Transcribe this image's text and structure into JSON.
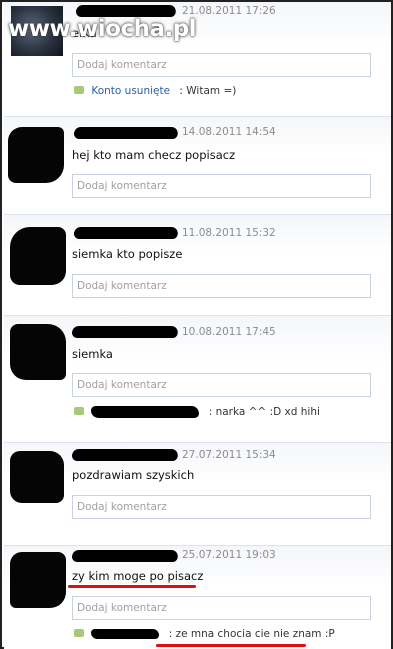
{
  "watermark": "www.wiocha.pl",
  "comment_placeholder": "Dodaj komentarz",
  "posts": [
    {
      "date": "21.08.2011 17:26",
      "text": "elKa",
      "reply": {
        "author": "Konto usunięte",
        "text": ": Witam =)"
      }
    },
    {
      "date": "14.08.2011 14:54",
      "text": "hej kto mam checz popisacz"
    },
    {
      "date": "11.08.2011 15:32",
      "text": "siemka kto popisze"
    },
    {
      "date": "10.08.2011 17:45",
      "text": "siemka",
      "reply": {
        "text": ": narka ^^ :D xd hihi"
      }
    },
    {
      "date": "27.07.2011 15:34",
      "text": "pozdrawiam szyskich"
    },
    {
      "date": "25.07.2011 19:03",
      "text": "zy kim moge po pisacz",
      "reply": {
        "text": ": ze mna chocia cie nie znam :P"
      }
    }
  ],
  "colors": {
    "highlight": "#e01010",
    "link": "#2b5ea8"
  }
}
